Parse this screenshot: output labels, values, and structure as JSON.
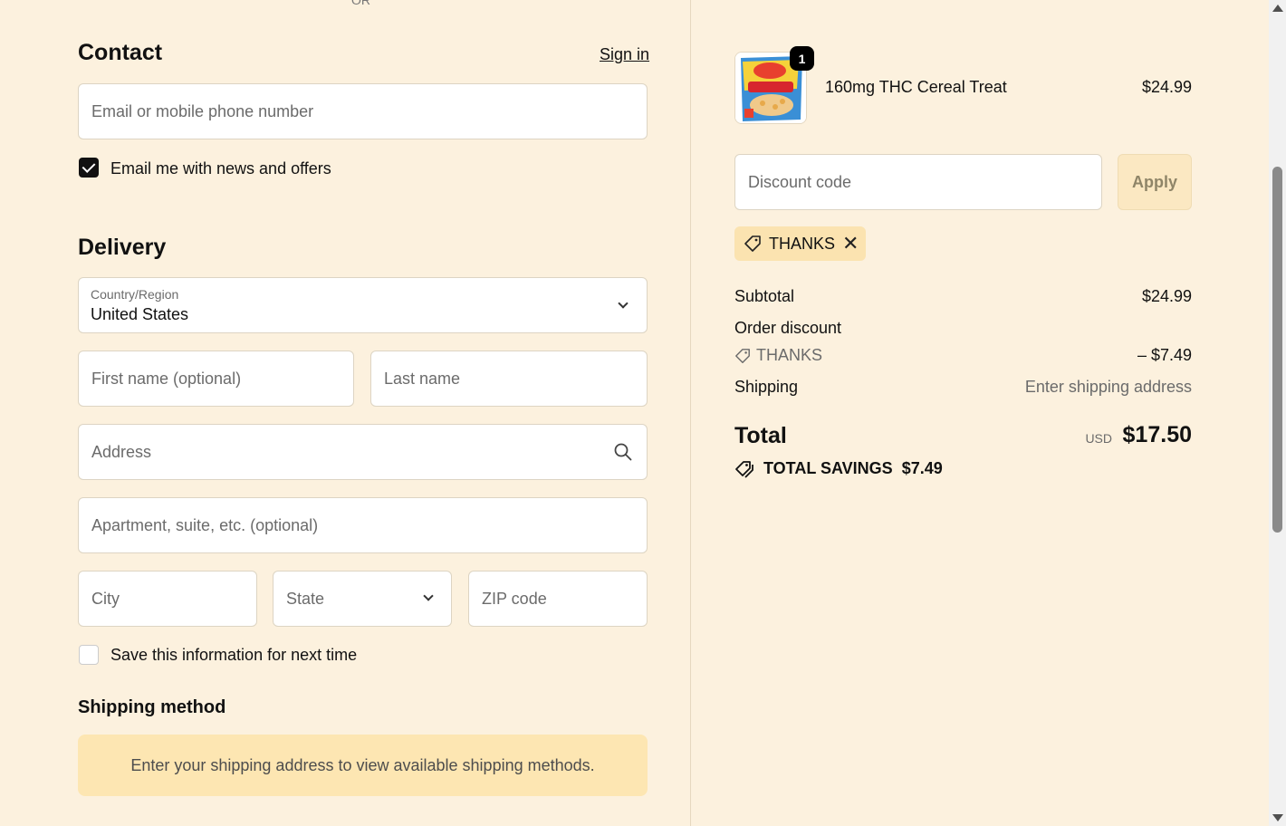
{
  "top": {
    "or_text": "OR"
  },
  "contact": {
    "heading": "Contact",
    "sign_in": "Sign in",
    "email_placeholder": "Email or mobile phone number",
    "news_checkbox_label": "Email me with news and offers",
    "news_checked": true
  },
  "delivery": {
    "heading": "Delivery",
    "country_label": "Country/Region",
    "country_value": "United States",
    "first_name_placeholder": "First name (optional)",
    "last_name_placeholder": "Last name",
    "address_placeholder": "Address",
    "apartment_placeholder": "Apartment, suite, etc. (optional)",
    "city_placeholder": "City",
    "state_placeholder": "State",
    "zip_placeholder": "ZIP code",
    "save_info_label": "Save this information for next time",
    "save_info_checked": false
  },
  "shipping_method": {
    "heading": "Shipping method",
    "notice": "Enter your shipping address to view available shipping methods."
  },
  "summary": {
    "item": {
      "quantity": "1",
      "name": "160mg THC Cereal Treat",
      "price": "$24.99",
      "image_icon": "product-thumbnail"
    },
    "discount_placeholder": "Discount code",
    "apply_label": "Apply",
    "applied_code": "THANKS",
    "subtotal_label": "Subtotal",
    "subtotal_value": "$24.99",
    "order_discount_label": "Order discount",
    "order_discount_code": "THANKS",
    "order_discount_value": "– $7.49",
    "shipping_label": "Shipping",
    "shipping_value": "Enter shipping address",
    "total_label": "Total",
    "total_currency": "USD",
    "total_value": "$17.50",
    "savings_label": "TOTAL SAVINGS",
    "savings_value": "$7.49"
  },
  "colors": {
    "background": "#fcf1de",
    "notice_bg": "#fde6b2",
    "chip_bg": "#fbe3b0",
    "apply_bg": "#fbe8c2"
  }
}
